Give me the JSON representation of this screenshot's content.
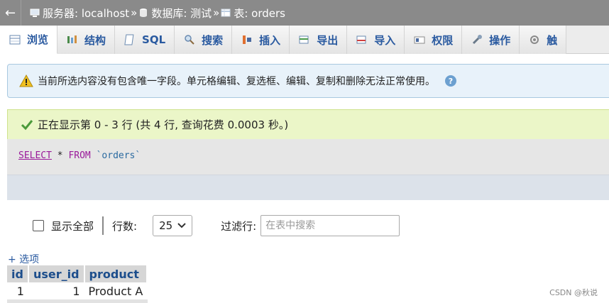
{
  "breadcrumb": {
    "back": "←",
    "server_label": "服务器: localhost",
    "sep": "»",
    "database_label": "数据库: 测试",
    "table_label": "表: orders"
  },
  "tabs": [
    {
      "label": "浏览",
      "icon": "browse-icon"
    },
    {
      "label": "结构",
      "icon": "structure-icon"
    },
    {
      "label": "SQL",
      "icon": "sql-icon"
    },
    {
      "label": "搜索",
      "icon": "search-icon"
    },
    {
      "label": "插入",
      "icon": "insert-icon"
    },
    {
      "label": "导出",
      "icon": "export-icon"
    },
    {
      "label": "导入",
      "icon": "import-icon"
    },
    {
      "label": "权限",
      "icon": "privileges-icon"
    },
    {
      "label": "操作",
      "icon": "operations-icon"
    },
    {
      "label": "触",
      "icon": "triggers-icon"
    }
  ],
  "notice": {
    "text": "当前所选内容没有包含唯一字段。单元格编辑、复选框、编辑、复制和删除无法正常使用。"
  },
  "success": {
    "text": "正在显示第 0 - 3 行 (共 4 行, 查询花费 0.0003 秒。)"
  },
  "sql": {
    "select": "SELECT",
    "star": " * ",
    "from": "FROM",
    "table": "`orders`"
  },
  "nav": {
    "show_all": "显示全部",
    "rows_label": "行数:",
    "rows_value": "25",
    "filter_label": "过滤行:",
    "filter_placeholder": "在表中搜索"
  },
  "options_link": "+ 选项",
  "table": {
    "columns": [
      "id",
      "user_id",
      "product"
    ],
    "rows": [
      [
        "1",
        "1",
        "Product A"
      ]
    ]
  },
  "watermark": "CSDN @秋说",
  "colors": {
    "topbar": "#8a8a8a",
    "link": "#2a5aa0",
    "success_bg": "#ebf6c8",
    "notice_bg": "#e8f2fa"
  }
}
